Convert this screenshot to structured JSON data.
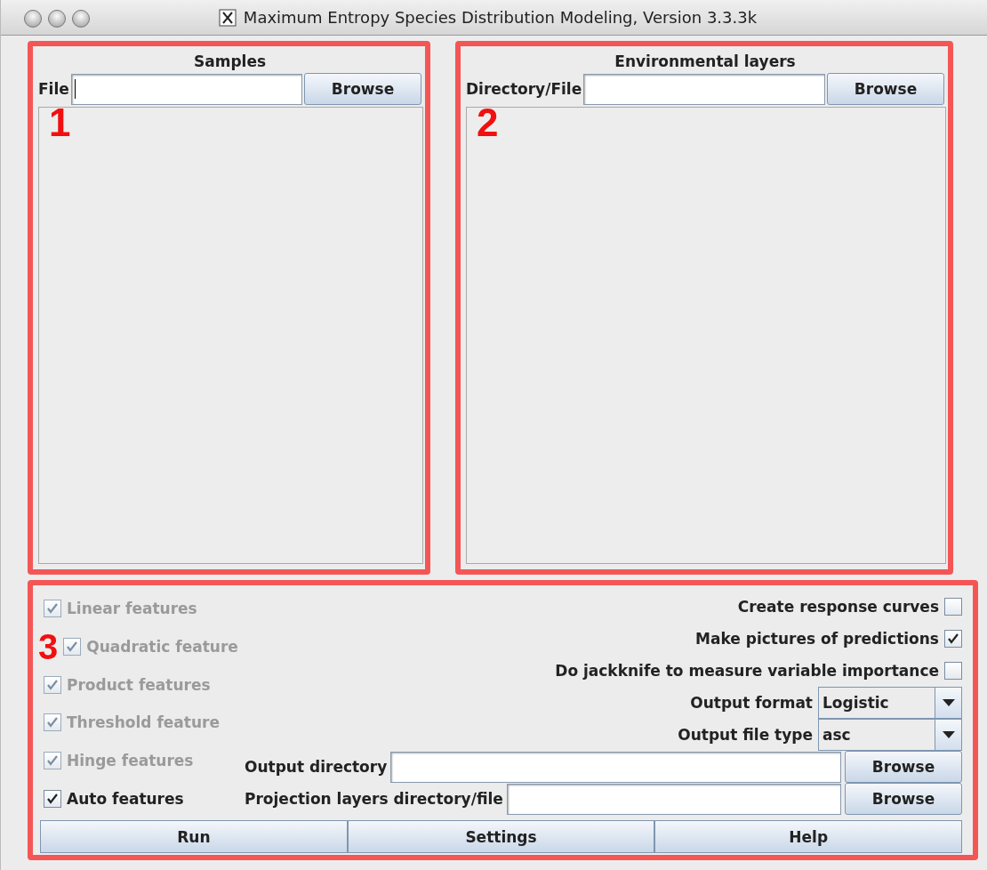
{
  "window": {
    "title": "Maximum Entropy Species Distribution Modeling, Version 3.3.3k"
  },
  "samples": {
    "annotation": "1",
    "heading": "Samples",
    "label": "File",
    "focused": true,
    "button": "Browse"
  },
  "layers": {
    "annotation": "2",
    "heading": "Environmental layers",
    "label": "Directory/File",
    "focused": false,
    "button": "Browse"
  },
  "options": {
    "annotation": "3",
    "features": [
      {
        "label": "Linear features",
        "checked": true,
        "disabled": true
      },
      {
        "label": "Quadratic feature",
        "checked": true,
        "disabled": true
      },
      {
        "label": "Product features",
        "checked": true,
        "disabled": true
      },
      {
        "label": "Threshold feature",
        "checked": true,
        "disabled": true
      },
      {
        "label": "Hinge features",
        "checked": true,
        "disabled": true
      },
      {
        "label": "Auto features",
        "checked": true,
        "disabled": false
      }
    ],
    "rows": [
      {
        "kind": "check",
        "label": "Create response curves",
        "checked": false
      },
      {
        "kind": "check",
        "label": "Make pictures of predictions",
        "checked": true
      },
      {
        "kind": "check",
        "label": "Do jackknife to measure variable importance",
        "checked": false
      },
      {
        "kind": "combo",
        "label": "Output format",
        "value": "Logistic"
      },
      {
        "kind": "combo",
        "label": "Output file type",
        "value": "asc"
      },
      {
        "kind": "path",
        "label": "Output directory",
        "button": "Browse"
      },
      {
        "kind": "path",
        "label": "Projection layers directory/file",
        "button": "Browse"
      }
    ],
    "buttons": [
      "Run",
      "Settings",
      "Help"
    ]
  }
}
